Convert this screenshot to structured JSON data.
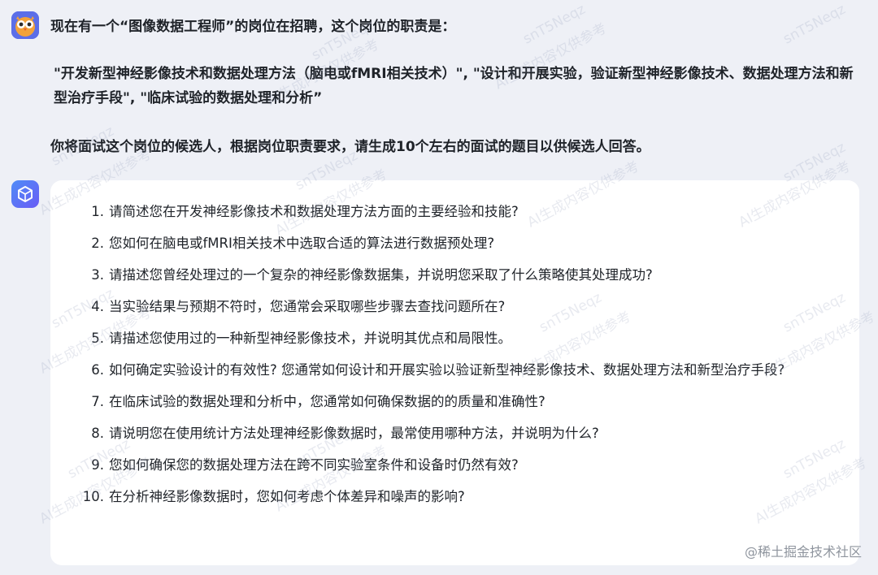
{
  "user_avatar": {
    "icon": "owl-avatar-icon",
    "accent": "#5b6ee8"
  },
  "bot_avatar": {
    "icon": "cube-logo-icon",
    "accent": "#4f8cf7"
  },
  "user_message": {
    "line1": "现在有一个“图像数据工程师”的岗位在招聘，这个岗位的职责是：",
    "line2": " \"开发新型神经影像技术和数据处理方法（脑电或fMRI相关技术）\", \"设计和开展实验，验证新型神经影像技术、数据处理方法和新型治疗手段\", \"临床试验的数据处理和分析”",
    "line3": "你将面试这个岗位的候选人，根据岗位职责要求，请生成10个左右的面试的题目以供候选人回答。"
  },
  "answer_items": [
    {
      "num": "1.",
      "text": "请简述您在开发神经影像技术和数据处理方法方面的主要经验和技能?"
    },
    {
      "num": "2.",
      "text": "您如何在脑电或fMRI相关技术中选取合适的算法进行数据预处理?"
    },
    {
      "num": "3.",
      "text": "请描述您曾经处理过的一个复杂的神经影像数据集，并说明您采取了什么策略使其处理成功?"
    },
    {
      "num": "4.",
      "text": "当实验结果与预期不符时，您通常会采取哪些步骤去查找问题所在?"
    },
    {
      "num": "5.",
      "text": "请描述您使用过的一种新型神经影像技术，并说明其优点和局限性。"
    },
    {
      "num": "6.",
      "text": "如何确定实验设计的有效性? 您通常如何设计和开展实验以验证新型神经影像技术、数据处理方法和新型治疗手段?"
    },
    {
      "num": "7.",
      "text": "在临床试验的数据处理和分析中，您通常如何确保数据的的质量和准确性?"
    },
    {
      "num": "8.",
      "text": "请说明您在使用统计方法处理神经影像数据时，最常使用哪种方法，并说明为什么?"
    },
    {
      "num": "9.",
      "text": "您如何确保您的数据处理方法在跨不同实验室条件和设备时仍然有效?"
    },
    {
      "num": "10.",
      "text": "在分析神经影像数据时，您如何考虑个体差异和噪声的影响?"
    }
  ],
  "watermark": {
    "code": "snT5Neqz",
    "note": "AI生成内容仅供参考"
  },
  "footer": {
    "logo_text": "@稀土掘金技术社区"
  }
}
